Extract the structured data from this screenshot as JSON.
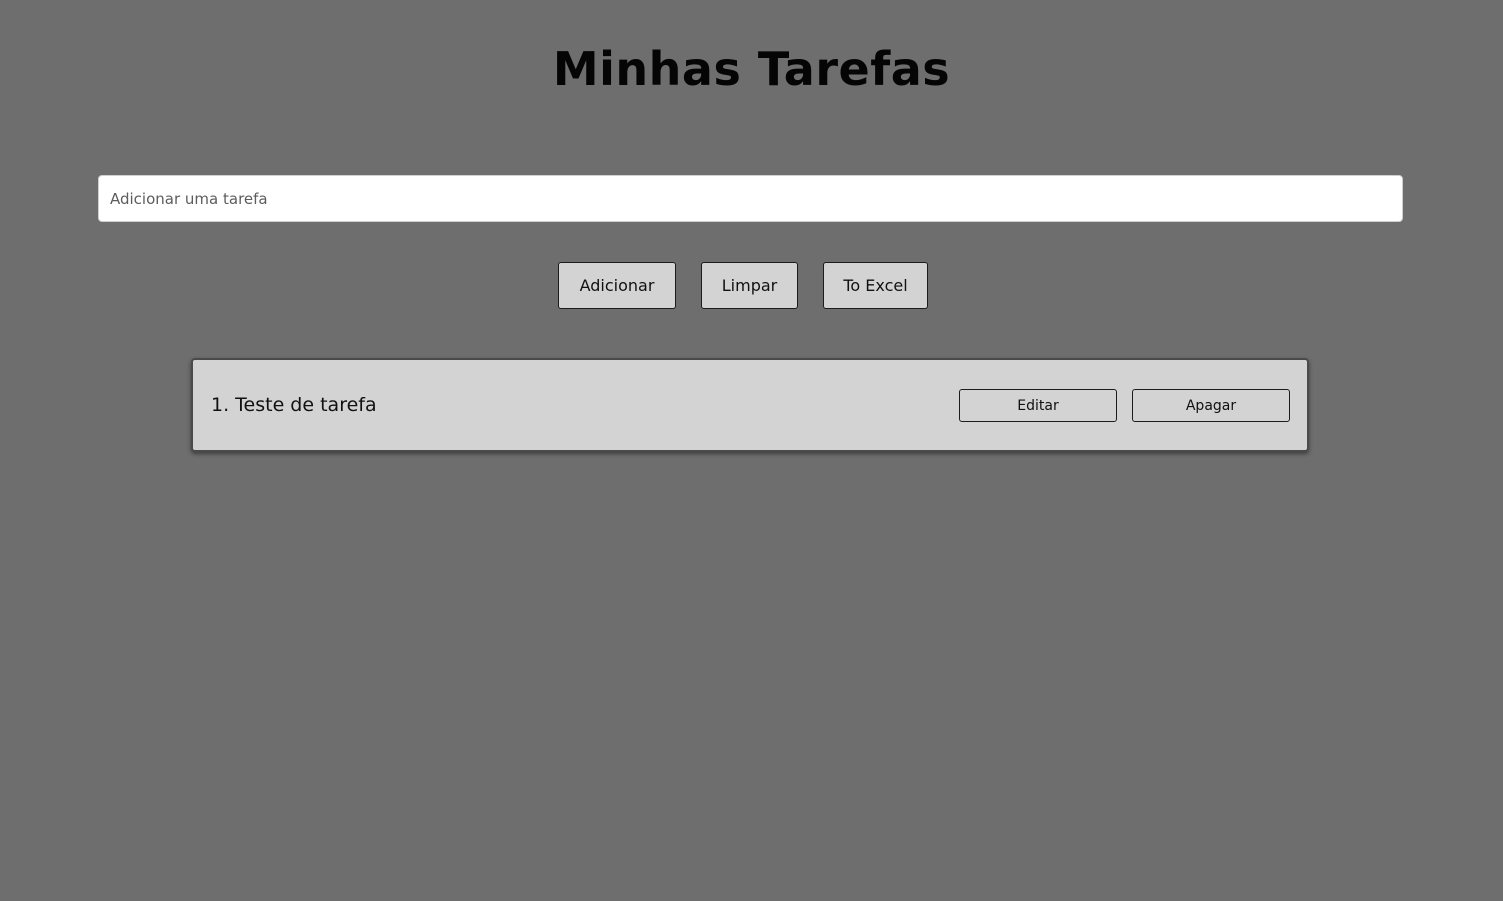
{
  "page": {
    "title": "Minhas Tarefas"
  },
  "input": {
    "value": "",
    "placeholder": "Adicionar uma tarefa"
  },
  "actions": {
    "add_label": "Adicionar",
    "clear_label": "Limpar",
    "excel_label": "To Excel"
  },
  "tasks": [
    {
      "text": "1. Teste de tarefa",
      "edit_label": "Editar",
      "delete_label": "Apagar"
    }
  ],
  "colors": {
    "background": "#6e6e6e",
    "card": "#d3d3d3",
    "input": "#ffffff",
    "text": "#111111"
  }
}
